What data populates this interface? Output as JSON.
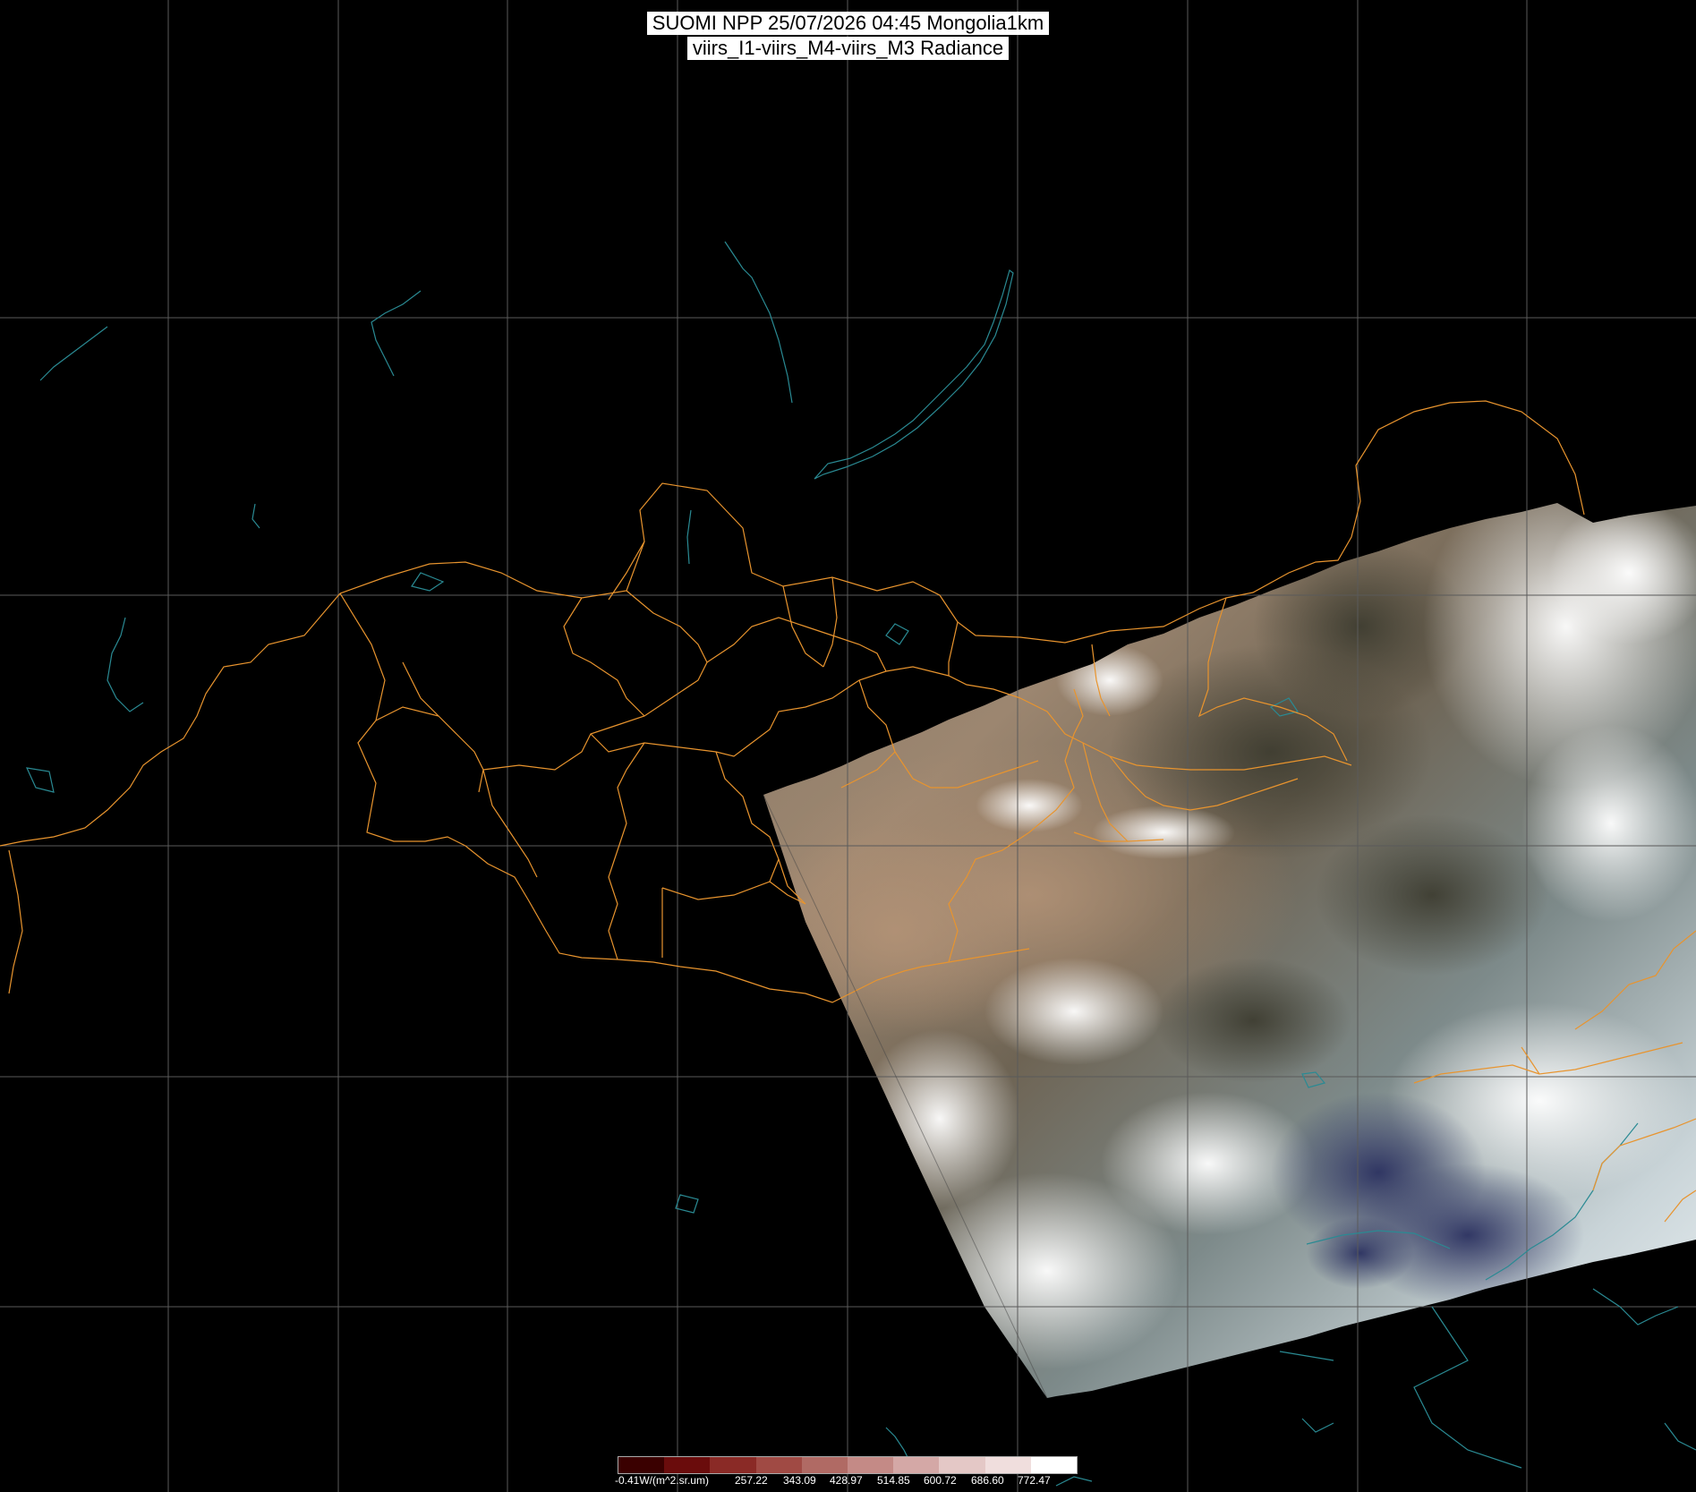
{
  "header": {
    "line1": "SUOMI NPP 25/07/2026 04:45 Mongolia1km",
    "line2": "viirs_I1-viirs_M4-viirs_M3 Radiance"
  },
  "map": {
    "grid_color": "#5a5a5a",
    "border_color": "#e8942e",
    "coast_color": "#2a8a93",
    "lakes_color": "#2a8a93",
    "background": "#000000"
  },
  "legend": {
    "unit_label": "-0.41W/(m^2.sr.um)",
    "ticks": [
      "257.22",
      "343.09",
      "428.97",
      "514.85",
      "600.72",
      "686.60",
      "772.47"
    ],
    "colors": [
      "#3a0000",
      "#6a0c0c",
      "#8a2a26",
      "#a04a44",
      "#b06a64",
      "#c48a86",
      "#d4a8a6",
      "#e4c8c6",
      "#f0dedd",
      "#ffffff"
    ]
  }
}
